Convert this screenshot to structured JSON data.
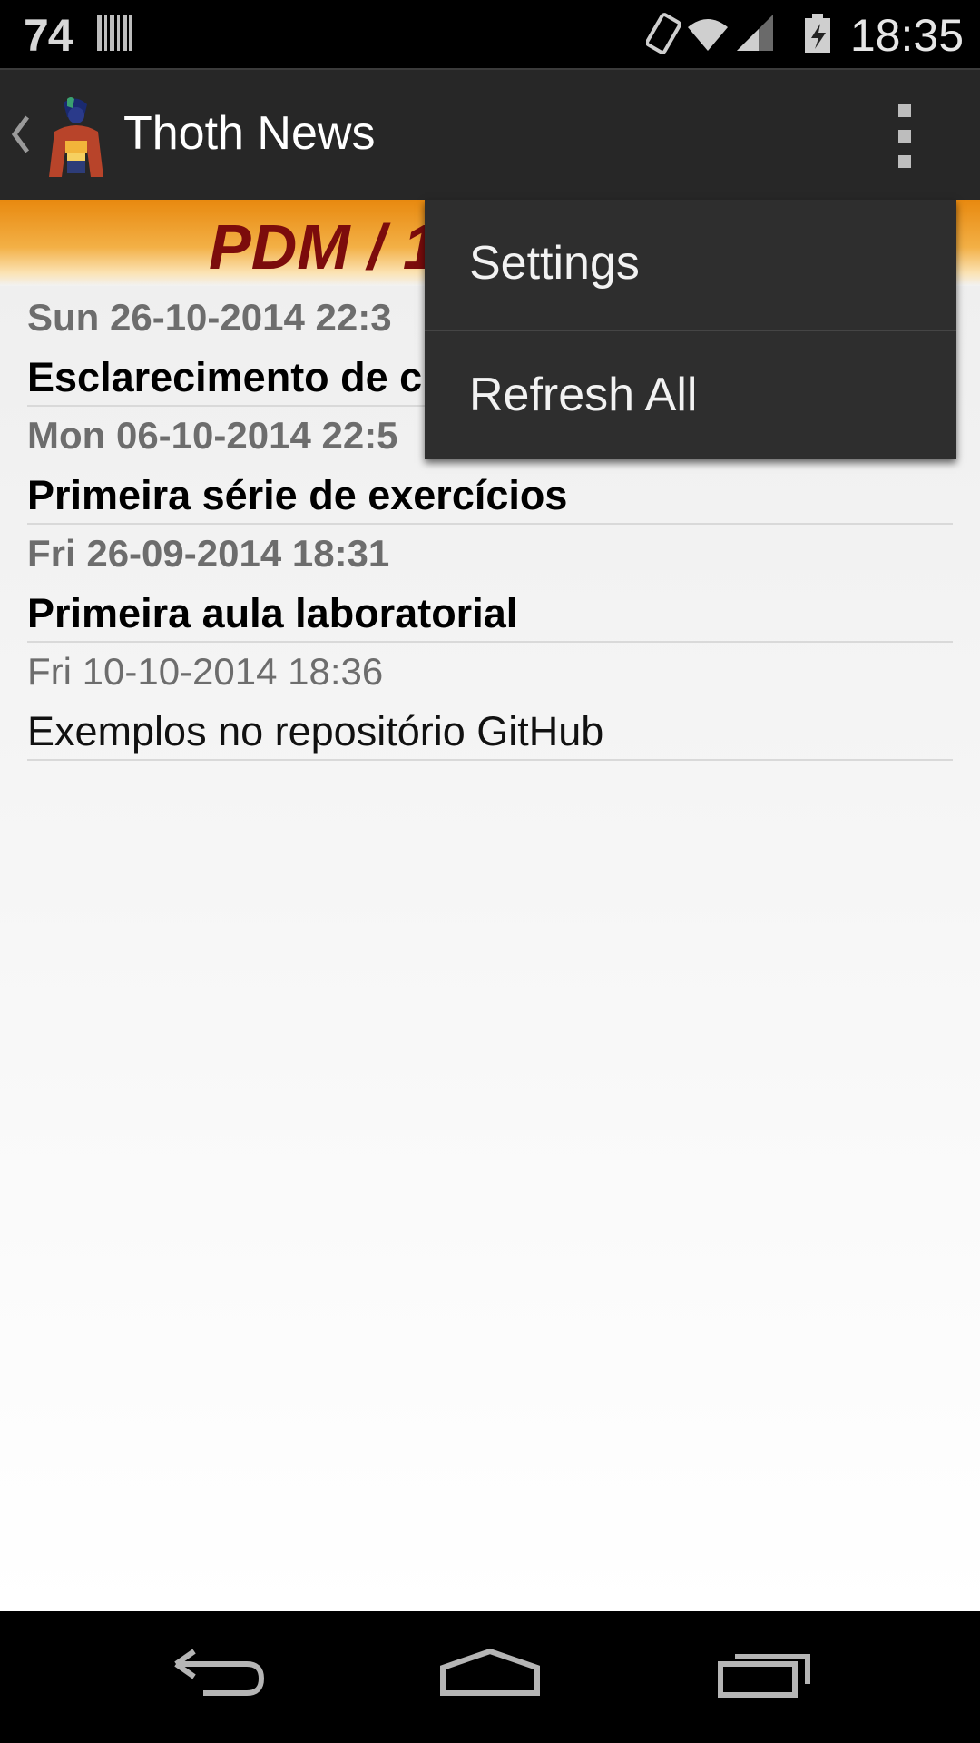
{
  "status_bar": {
    "left_number": "74",
    "time": "18:35",
    "icons": [
      "barcode-icon",
      "vibrate-icon",
      "wifi-icon",
      "signal-icon",
      "battery-charging-icon"
    ]
  },
  "action_bar": {
    "title": "Thoth News",
    "icons": [
      "back-chevron-icon",
      "app-logo",
      "overflow-menu-icon"
    ]
  },
  "header": {
    "title": "PDM / 1"
  },
  "news": [
    {
      "date": "Sun 26-10-2014 22:3",
      "title": "Esclarecimento de c",
      "unread": true
    },
    {
      "date": "Mon 06-10-2014 22:5",
      "title": "Primeira série de exercícios",
      "unread": true
    },
    {
      "date": "Fri 26-09-2014 18:31",
      "title": "Primeira aula laboratorial",
      "unread": true
    },
    {
      "date": "Fri 10-10-2014 18:36",
      "title": "Exemplos no repositório GitHub",
      "unread": false
    }
  ],
  "popup_menu": {
    "items": [
      "Settings",
      "Refresh All"
    ]
  },
  "nav_bar": {
    "icons": [
      "back-icon",
      "home-icon",
      "recents-icon"
    ]
  },
  "colors": {
    "header_title": "#7c0c0c",
    "header_band": "#f3b046",
    "action_bar": "#272727",
    "menu_bg": "#2e2e2e"
  }
}
